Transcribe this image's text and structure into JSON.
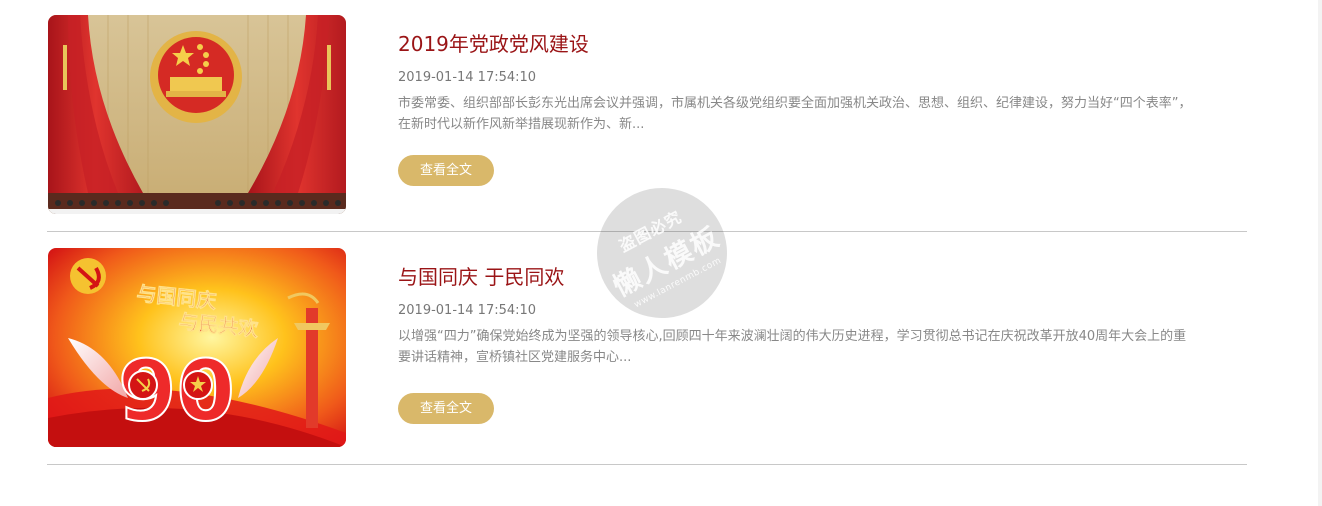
{
  "articles": [
    {
      "title": "2019年党政党风建设",
      "date": "2019-01-14 17:54:10",
      "summary": "市委常委、组织部部长彭东光出席会议并强调，市属机关各级党组织要全面加强机关政治、思想、组织、纪律建设，努力当好“四个表率”，在新时代以新作风新举措展现新作为、新...",
      "button_label": "查看全文",
      "image": "national-emblem-hall-photo"
    },
    {
      "title": "与国同庆 于民同欢",
      "date": "2019-01-14 17:54:10",
      "summary": "以增强“四力”确保党始终成为坚强的领导核心,回顾四十年来波澜壮阔的伟大历史进程，学习贯彻总书记在庆祝改革开放40周年大会上的重要讲话精神，宣桥镇社区党建服务中心...",
      "button_label": "查看全文",
      "image": "party-90th-anniversary-poster",
      "image_text": {
        "line1": "与国同庆",
        "line2": "与民共欢",
        "number": "90"
      }
    }
  ],
  "watermark": {
    "top": "盗图必究",
    "middle": "懒人模板",
    "url": "www.lanrenmb.com"
  },
  "colors": {
    "title": "#9a1416",
    "button": "#d9b86a",
    "divider": "#c8c8c8"
  }
}
